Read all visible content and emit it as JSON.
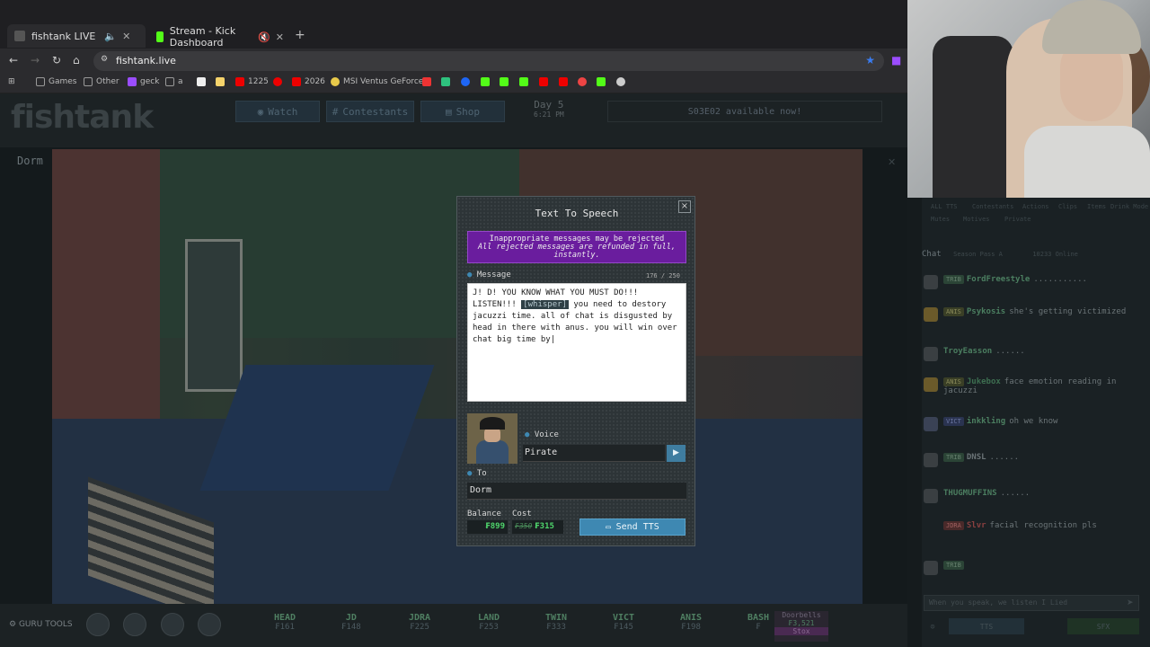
{
  "browser": {
    "tabs": [
      {
        "label": "fishtank LIVE",
        "active": true
      },
      {
        "label": "Stream - Kick Dashboard",
        "active": false
      }
    ],
    "url": "fishtank.live",
    "bookmarks": [
      "Games",
      "Other",
      "geck",
      "a",
      "1225",
      "2026",
      "MSI Ventus GeForce..."
    ]
  },
  "site": {
    "logo": "fishtank",
    "nav": {
      "watch": "Watch",
      "contestants": "Contestants",
      "shop": "Shop"
    },
    "day": {
      "label": "Day 5",
      "time": "6:21 PM"
    },
    "announcement": "S03E02 available now!",
    "room": "Dorm",
    "gurutools": "GURU TOOLS",
    "contestants": [
      {
        "name": "HEAD",
        "value": "₣161"
      },
      {
        "name": "JD",
        "value": "₣148"
      },
      {
        "name": "JDRA",
        "value": "₣225"
      },
      {
        "name": "LAND",
        "value": "₣253"
      },
      {
        "name": "TWIN",
        "value": "₣333"
      },
      {
        "name": "VICT",
        "value": "₣145"
      },
      {
        "name": "ANIS",
        "value": "₣198"
      },
      {
        "name": "BASH",
        "value": "₣"
      }
    ],
    "room_stats": {
      "title": "Doorbells",
      "value": "₣3,521",
      "link": "Stox"
    }
  },
  "chat": {
    "filters": [
      "ALL TTS",
      "Contestants",
      "Actions",
      "Clips",
      "Items",
      "Drink Mode"
    ],
    "filters2": [
      "Mutes",
      "Motives",
      "Private"
    ],
    "title": "Chat",
    "season_pass": "Season Pass A",
    "online": "10233 Online",
    "messages": [
      {
        "badge": "TRIB",
        "user": "FordFreestyle",
        "text": "..........."
      },
      {
        "badge": "ANIS",
        "user": "Psykosis",
        "text": "she's getting victimized"
      },
      {
        "badge": "TRIB",
        "user": "TroyEasson",
        "text": "......"
      },
      {
        "badge": "ANIS",
        "user": "Jukebox",
        "text": "face emotion reading in jacuzzi"
      },
      {
        "badge": "VICT",
        "user": "inkkling",
        "text": "oh we know"
      },
      {
        "badge": "TRIB",
        "user": "DNSL",
        "text": "......"
      },
      {
        "badge": "TRIB",
        "user": "THUGMUFFINS",
        "text": "......"
      },
      {
        "badge": "JDRA",
        "user": "Slvr",
        "text": "facial recognition pls"
      },
      {
        "badge": "TRIB",
        "user": "",
        "text": ""
      }
    ],
    "input_placeholder": "When you speak, we listen I Lied",
    "bottom": {
      "tts": "TTS",
      "sfx": "SFX"
    }
  },
  "tts": {
    "title": "Text To Speech",
    "close": "×",
    "warning_line1": "Inappropriate messages may be rejected",
    "warning_line2": "All rejected messages are refunded in full, instantly.",
    "message_label": "Message",
    "char_count": "176 / 250",
    "message_before": "J! D! YOU KNOW WHAT YOU MUST DO!!! LISTEN!!! ",
    "message_tag": "[whisper]",
    "message_after": " you need to destory jacuzzi time. all of chat is disgusted by head in there with anus. you will win over chat big time by",
    "voice_label": "Voice",
    "voice_value": "Pirate",
    "to_label": "To",
    "to_value": "Dorm",
    "balance_label": "Balance",
    "balance_value": "₣899",
    "cost_label": "Cost",
    "cost_old": "₣350",
    "cost_new": "₣315",
    "send_label": "Send TTS"
  }
}
